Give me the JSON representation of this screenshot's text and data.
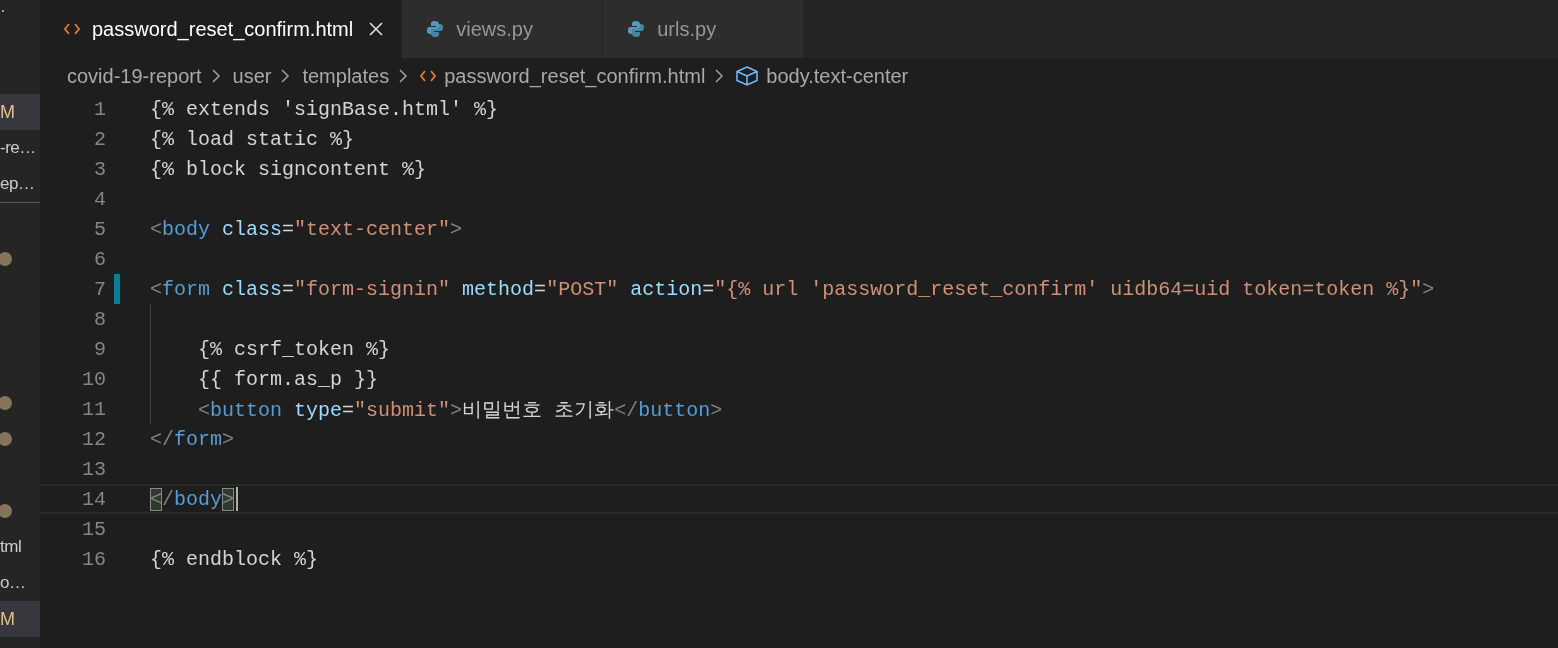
{
  "sidebar": {
    "items": [
      {
        "kind": "text",
        "text": "·"
      },
      {
        "kind": "blank"
      },
      {
        "kind": "header",
        "text": "M"
      },
      {
        "kind": "text",
        "text": "-re…"
      },
      {
        "kind": "text",
        "text": "ep…"
      },
      {
        "kind": "divider"
      },
      {
        "kind": "dot"
      },
      {
        "kind": "blank"
      },
      {
        "kind": "blank"
      },
      {
        "kind": "blank"
      },
      {
        "kind": "dot"
      },
      {
        "kind": "dot"
      },
      {
        "kind": "blank"
      },
      {
        "kind": "dot"
      },
      {
        "kind": "text",
        "text": "tml"
      },
      {
        "kind": "text",
        "text": "o…"
      },
      {
        "kind": "header",
        "text": "M"
      }
    ]
  },
  "tabs": [
    {
      "label": "password_reset_confirm.html",
      "kind": "html",
      "selected": true
    },
    {
      "label": "views.py",
      "kind": "python",
      "selected": false
    },
    {
      "label": "urls.py",
      "kind": "python",
      "selected": false
    }
  ],
  "breadcrumb": [
    {
      "label": "covid-19-report",
      "kind": "folder"
    },
    {
      "label": "user",
      "kind": "folder"
    },
    {
      "label": "templates",
      "kind": "folder"
    },
    {
      "label": "password_reset_confirm.html",
      "kind": "html"
    },
    {
      "label": "body.text-center",
      "kind": "symbol"
    }
  ],
  "lines": [
    {
      "number": "1",
      "modified": false,
      "current": false,
      "guide": false,
      "tokens": [
        {
          "kind": "plain",
          "text": "{% extends 'signBase.html' %}"
        }
      ]
    },
    {
      "number": "2",
      "modified": false,
      "current": false,
      "guide": false,
      "tokens": [
        {
          "kind": "plain",
          "text": "{% load static %}"
        }
      ]
    },
    {
      "number": "3",
      "modified": false,
      "current": false,
      "guide": false,
      "tokens": [
        {
          "kind": "plain",
          "text": "{% block signcontent %}"
        }
      ]
    },
    {
      "number": "4",
      "modified": false,
      "current": false,
      "guide": false
    },
    {
      "number": "5",
      "modified": false,
      "current": false,
      "guide": false,
      "tokens": [
        {
          "kind": "bracket",
          "text": "<"
        },
        {
          "kind": "tag",
          "text": "body"
        },
        {
          "kind": "attr",
          "text": " class"
        },
        {
          "kind": "plain",
          "text": "="
        },
        {
          "kind": "string",
          "text": "\"text-center\""
        },
        {
          "kind": "bracket",
          "text": ">"
        }
      ]
    },
    {
      "number": "6",
      "modified": false,
      "current": false,
      "guide": false
    },
    {
      "number": "7",
      "modified": true,
      "current": false,
      "guide": false,
      "tokens": [
        {
          "kind": "bracket",
          "text": "<"
        },
        {
          "kind": "tag",
          "text": "form"
        },
        {
          "kind": "attr",
          "text": " class"
        },
        {
          "kind": "plain",
          "text": "="
        },
        {
          "kind": "string",
          "text": "\"form-signin\""
        },
        {
          "kind": "attr",
          "text": " method"
        },
        {
          "kind": "plain",
          "text": "="
        },
        {
          "kind": "string",
          "text": "\"POST\""
        },
        {
          "kind": "attr",
          "text": " action"
        },
        {
          "kind": "plain",
          "text": "="
        },
        {
          "kind": "string",
          "text": "\"{% url 'password_reset_confirm' uidb64=uid token=token %}\""
        },
        {
          "kind": "bracket",
          "text": ">"
        }
      ]
    },
    {
      "number": "8",
      "modified": false,
      "current": false,
      "guide": true
    },
    {
      "number": "9",
      "modified": false,
      "current": false,
      "guide": true,
      "tokens": [
        {
          "kind": "plain",
          "text": "    {% csrf_token %}"
        }
      ]
    },
    {
      "number": "10",
      "modified": false,
      "current": false,
      "guide": true,
      "tokens": [
        {
          "kind": "plain",
          "text": "    {{ form.as_p }}"
        }
      ]
    },
    {
      "number": "11",
      "modified": false,
      "current": false,
      "guide": true,
      "tokens": [
        {
          "kind": "bracket",
          "text": "    <"
        },
        {
          "kind": "tag",
          "text": "button"
        },
        {
          "kind": "attr",
          "text": " type"
        },
        {
          "kind": "plain",
          "text": "="
        },
        {
          "kind": "string",
          "text": "\"submit\""
        },
        {
          "kind": "bracket",
          "text": ">"
        },
        {
          "kind": "plain",
          "text": "비밀번호 초기화"
        },
        {
          "kind": "bracket",
          "text": "</"
        },
        {
          "kind": "tag",
          "text": "button"
        },
        {
          "kind": "bracket",
          "text": ">"
        }
      ]
    },
    {
      "number": "12",
      "modified": false,
      "current": false,
      "guide": false,
      "tokens": [
        {
          "kind": "bracket",
          "text": "</"
        },
        {
          "kind": "tag",
          "text": "form"
        },
        {
          "kind": "bracket",
          "text": ">"
        }
      ]
    },
    {
      "number": "13",
      "modified": false,
      "current": false,
      "guide": false
    },
    {
      "number": "14",
      "modified": false,
      "current": true,
      "guide": false,
      "tokens": [
        {
          "kind": "match",
          "text": "<"
        },
        {
          "kind": "bracket",
          "text": "/"
        },
        {
          "kind": "tag",
          "text": "body"
        },
        {
          "kind": "match",
          "text": ">"
        }
      ]
    },
    {
      "number": "15",
      "modified": false,
      "current": false,
      "guide": false
    },
    {
      "number": "16",
      "modified": false,
      "current": false,
      "guide": false,
      "tokens": [
        {
          "kind": "plain",
          "text": "{% endblock %}"
        }
      ]
    }
  ]
}
